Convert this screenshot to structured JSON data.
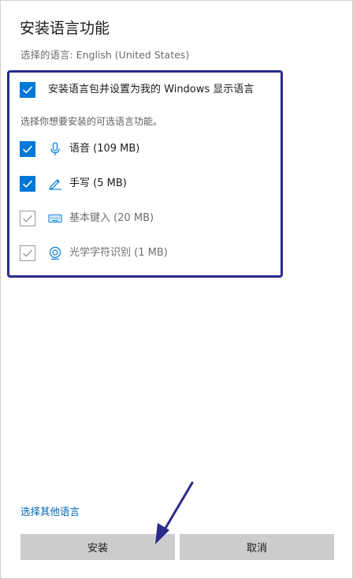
{
  "window": {
    "title": "安装语言功能",
    "selected_language_label": "选择的语言: English (United States)"
  },
  "main_option": {
    "label": "安装语言包并设置为我的 Windows 显示语言",
    "checked": true
  },
  "features": {
    "section_label": "选择你想要安装的可选语言功能。",
    "items": [
      {
        "label": "语音 (109 MB)",
        "icon": "microphone-icon",
        "checked": true,
        "disabled": false
      },
      {
        "label": "手写 (5 MB)",
        "icon": "pen-icon",
        "checked": true,
        "disabled": false
      },
      {
        "label": "基本键入 (20 MB)",
        "icon": "keyboard-icon",
        "checked": true,
        "disabled": true
      },
      {
        "label": "光学字符识别 (1 MB)",
        "icon": "ocr-icon",
        "checked": true,
        "disabled": true
      }
    ]
  },
  "footer": {
    "other_language_link": "选择其他语言",
    "install_label": "安装",
    "cancel_label": "取消"
  },
  "colors": {
    "accent": "#0078d7",
    "highlight_border": "#2b2a8c",
    "link": "#0066b4",
    "button_bg": "#cccccc"
  }
}
